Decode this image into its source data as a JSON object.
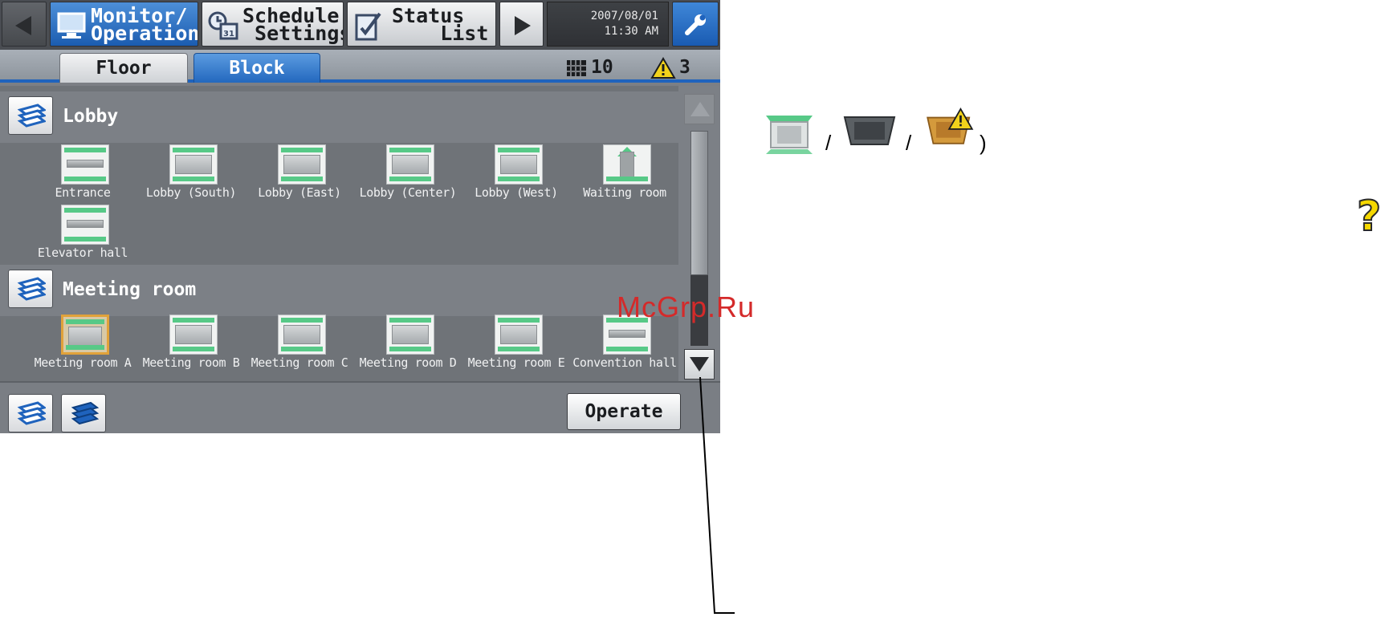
{
  "header": {
    "tabs": [
      {
        "label_line1": "Monitor/",
        "label_line2": "Operation",
        "icon": "monitor-icon",
        "active": true
      },
      {
        "label_line1": "Schedule",
        "label_line2": " Settings",
        "icon": "clock-calendar-icon"
      },
      {
        "label_line1": "Status",
        "label_line2": "    List",
        "icon": "status-list-icon"
      }
    ],
    "date": "2007/08/01",
    "time": "11:30 AM",
    "prev_icon": "left-arrow-icon",
    "next_icon": "right-arrow-icon",
    "settings_icon": "wrench-icon"
  },
  "view_tabs": {
    "floor": "Floor",
    "block": "Block"
  },
  "status": {
    "unit_count": "10",
    "alarm_count": "3"
  },
  "groups": [
    {
      "name": "Lobby",
      "units": [
        {
          "label": "Entrance",
          "type": "wall"
        },
        {
          "label": "Lobby (South)",
          "type": "cassette"
        },
        {
          "label": "Lobby (East)",
          "type": "cassette"
        },
        {
          "label": "Lobby (Center)",
          "type": "cassette"
        },
        {
          "label": "Lobby (West)",
          "type": "cassette"
        },
        {
          "label": "Waiting room",
          "type": "arrow"
        },
        {
          "label": "Elevator hall",
          "type": "wall"
        }
      ]
    },
    {
      "name": "Meeting room",
      "units": [
        {
          "label": "Meeting room A",
          "type": "cassette",
          "selected": true
        },
        {
          "label": "Meeting room B",
          "type": "cassette"
        },
        {
          "label": "Meeting room C",
          "type": "cassette"
        },
        {
          "label": "Meeting room D",
          "type": "cassette"
        },
        {
          "label": "Meeting room E",
          "type": "cassette"
        },
        {
          "label": "Convention hall",
          "type": "wall"
        }
      ]
    }
  ],
  "bottom": {
    "operate": "Operate"
  },
  "annotation": {
    "slash": "/",
    "close_paren": ")",
    "watermark": "McGrp.Ru",
    "help_icon": "?"
  },
  "colors": {
    "active_tab": "#1f63bd",
    "running_green": "#57c987",
    "selection": "#e1a23a",
    "alarm": "#f2d21b"
  }
}
